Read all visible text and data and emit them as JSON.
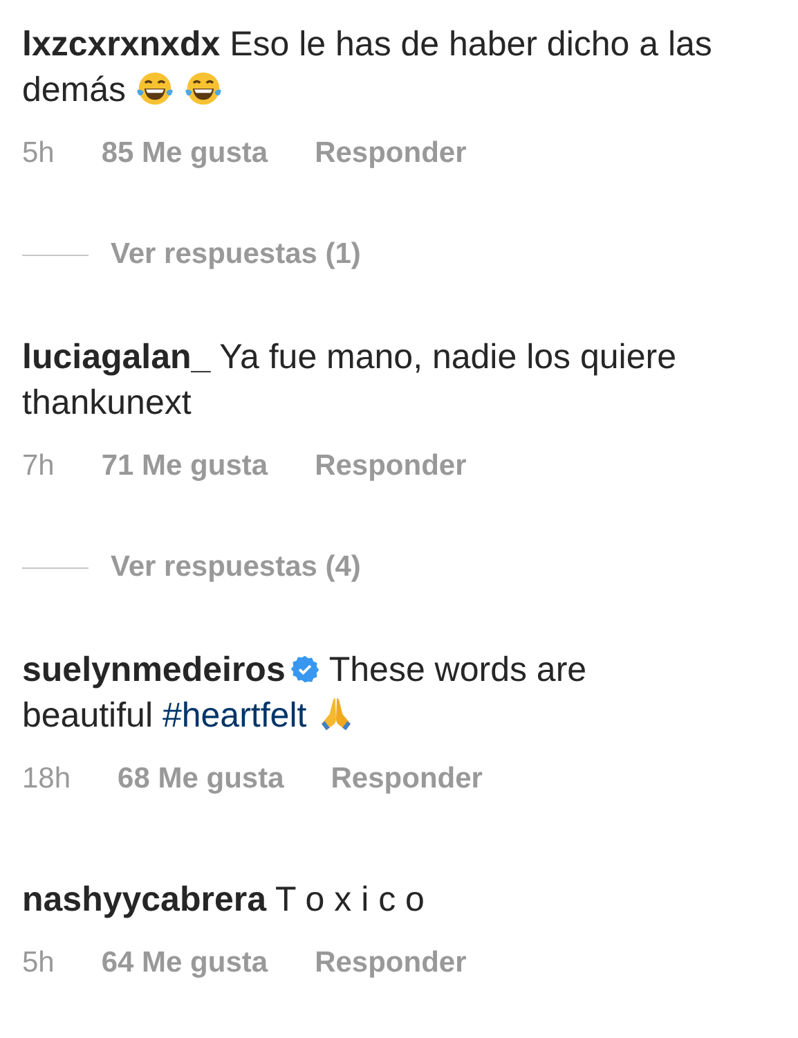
{
  "comments": [
    {
      "username": "lxzcxrxnxdx",
      "text": "Eso le has de haber dicho a las demás",
      "emojis": [
        {
          "kind": "laughing"
        },
        {
          "kind": "laughing"
        }
      ],
      "time": "5h",
      "likes": "85 Me gusta",
      "reply": "Responder",
      "view_replies": "Ver respuestas (1)"
    },
    {
      "username": "luciagalan_",
      "text": "Ya fue mano, nadie los quiere thankunext",
      "time": "7h",
      "likes": "71 Me gusta",
      "reply": "Responder",
      "view_replies": "Ver respuestas (4)"
    },
    {
      "username": "suelynmedeiros",
      "verified": true,
      "text": "These words are beautiful ",
      "hashtag": "#heartfelt",
      "emojis": [
        {
          "kind": "praying"
        }
      ],
      "time": "18h",
      "likes": "68 Me gusta",
      "reply": "Responder"
    },
    {
      "username": "nashyycabrera",
      "text": "T o x i c o",
      "time": "5h",
      "likes": "64 Me gusta",
      "reply": "Responder"
    }
  ]
}
